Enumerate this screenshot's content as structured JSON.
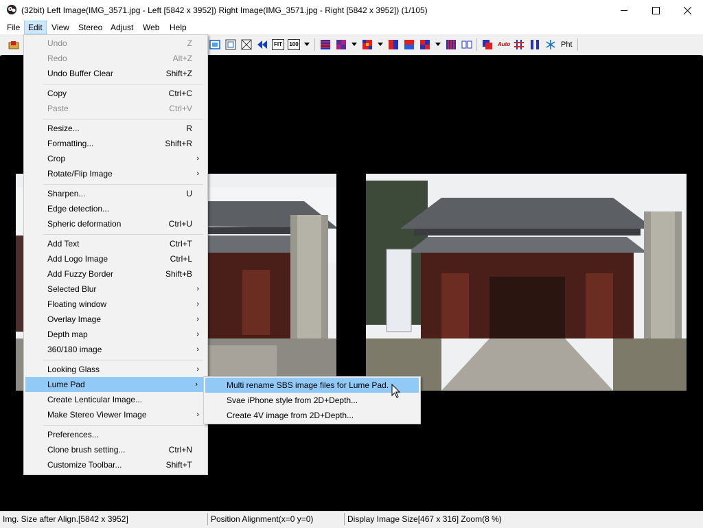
{
  "window": {
    "title": "(32bit) Left Image(IMG_3571.jpg - Left [5842 x 3952]) Right Image(IMG_3571.jpg - Right [5842 x 3952])  (1/105)",
    "minimize_icon": "minimize-icon",
    "maximize_icon": "maximize-icon",
    "close_icon": "close-icon"
  },
  "menubar": [
    "File",
    "Edit",
    "View",
    "Stereo",
    "Adjust",
    "Web",
    "Help"
  ],
  "active_menu": "Edit",
  "toolbar": {
    "fit_label": "FIT",
    "zoom100_label": "100",
    "auto_label": "Auto",
    "pht_label": "Pht"
  },
  "edit_menu": {
    "items": [
      {
        "label": "Undo",
        "shortcut": "Z",
        "disabled": true
      },
      {
        "label": "Redo",
        "shortcut": "Alt+Z",
        "disabled": true
      },
      {
        "label": "Undo Buffer Clear",
        "shortcut": "Shift+Z"
      },
      {
        "label": "Copy",
        "shortcut": "Ctrl+C"
      },
      {
        "label": "Paste",
        "shortcut": "Ctrl+V",
        "disabled": true
      },
      {
        "label": "Resize...",
        "shortcut": "R"
      },
      {
        "label": "Formatting...",
        "shortcut": "Shift+R"
      },
      {
        "label": "Crop",
        "submenu": true
      },
      {
        "label": "Rotate/Flip Image",
        "submenu": true
      },
      {
        "label": "Sharpen...",
        "shortcut": "U"
      },
      {
        "label": "Edge detection..."
      },
      {
        "label": "Spheric deformation",
        "shortcut": "Ctrl+U"
      },
      {
        "label": "Add Text",
        "shortcut": "Ctrl+T"
      },
      {
        "label": "Add Logo Image",
        "shortcut": "Ctrl+L"
      },
      {
        "label": "Add Fuzzy Border",
        "shortcut": "Shift+B"
      },
      {
        "label": "Selected Blur",
        "submenu": true
      },
      {
        "label": "Floating window",
        "submenu": true
      },
      {
        "label": "Overlay Image",
        "submenu": true
      },
      {
        "label": "Depth map",
        "submenu": true
      },
      {
        "label": "360/180 image",
        "submenu": true
      },
      {
        "label": "Looking Glass",
        "submenu": true
      },
      {
        "label": "Lume Pad",
        "submenu": true,
        "highlighted": true
      },
      {
        "label": "Create Lenticular Image..."
      },
      {
        "label": "Make Stereo Viewer Image",
        "submenu": true
      },
      {
        "label": "Preferences..."
      },
      {
        "label": "Clone brush setting...",
        "shortcut": "Ctrl+N"
      },
      {
        "label": "Customize Toolbar...",
        "shortcut": "Shift+T"
      }
    ]
  },
  "lume_pad_submenu": {
    "items": [
      {
        "label": "Multi rename SBS image files for Lume Pad.",
        "highlighted": true
      },
      {
        "label": "Svae iPhone style from 2D+Depth..."
      },
      {
        "label": "Create 4V image from 2D+Depth..."
      }
    ]
  },
  "status": {
    "img_size": "Img. Size after Align.[5842 x 3952]",
    "position": "Position Alignment(x=0 y=0)",
    "display": "Display Image Size[467 x 316]  Zoom(8 %)"
  },
  "colors": {
    "highlight": "#91c9f7",
    "menu_bg": "#f2f2f2",
    "canvas": "#000000"
  }
}
